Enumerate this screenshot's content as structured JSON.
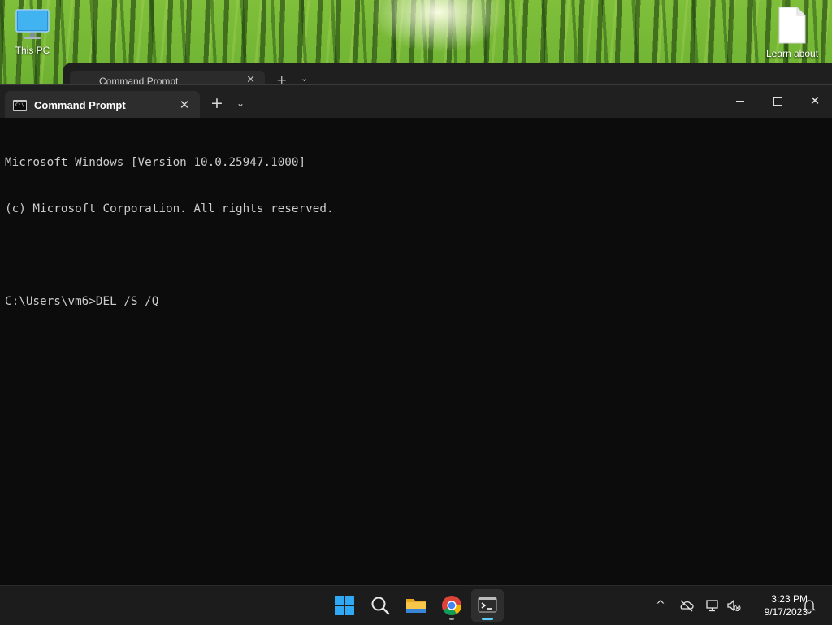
{
  "desktop": {
    "icons": [
      {
        "label": "This PC"
      },
      {
        "label": "Learn about"
      }
    ]
  },
  "background_window": {
    "tab_title": "Command Prompt",
    "close_glyph": "✕",
    "new_tab_glyph": "+",
    "dropdown_glyph": "⌄"
  },
  "window": {
    "tab": {
      "title": "Command Prompt",
      "icon_text": "C:\\",
      "close_glyph": "✕"
    },
    "new_tab_glyph": "+",
    "dropdown_glyph": "⌄",
    "close_glyph": "✕",
    "console_lines": [
      "Microsoft Windows [Version 10.0.25947.1000]",
      "(c) Microsoft Corporation. All rights reserved.",
      "",
      "C:\\Users\\vm6>DEL /S /Q"
    ]
  },
  "taskbar": {
    "clock": {
      "time": "3:23 PM",
      "date": "9/17/2023"
    },
    "tray": {
      "chevron_glyph": "^"
    }
  },
  "colors": {
    "console_bg": "#0c0c0c",
    "titlebar_bg": "#202020",
    "taskbar_bg": "#1c1c1c",
    "accent": "#60cdff"
  }
}
